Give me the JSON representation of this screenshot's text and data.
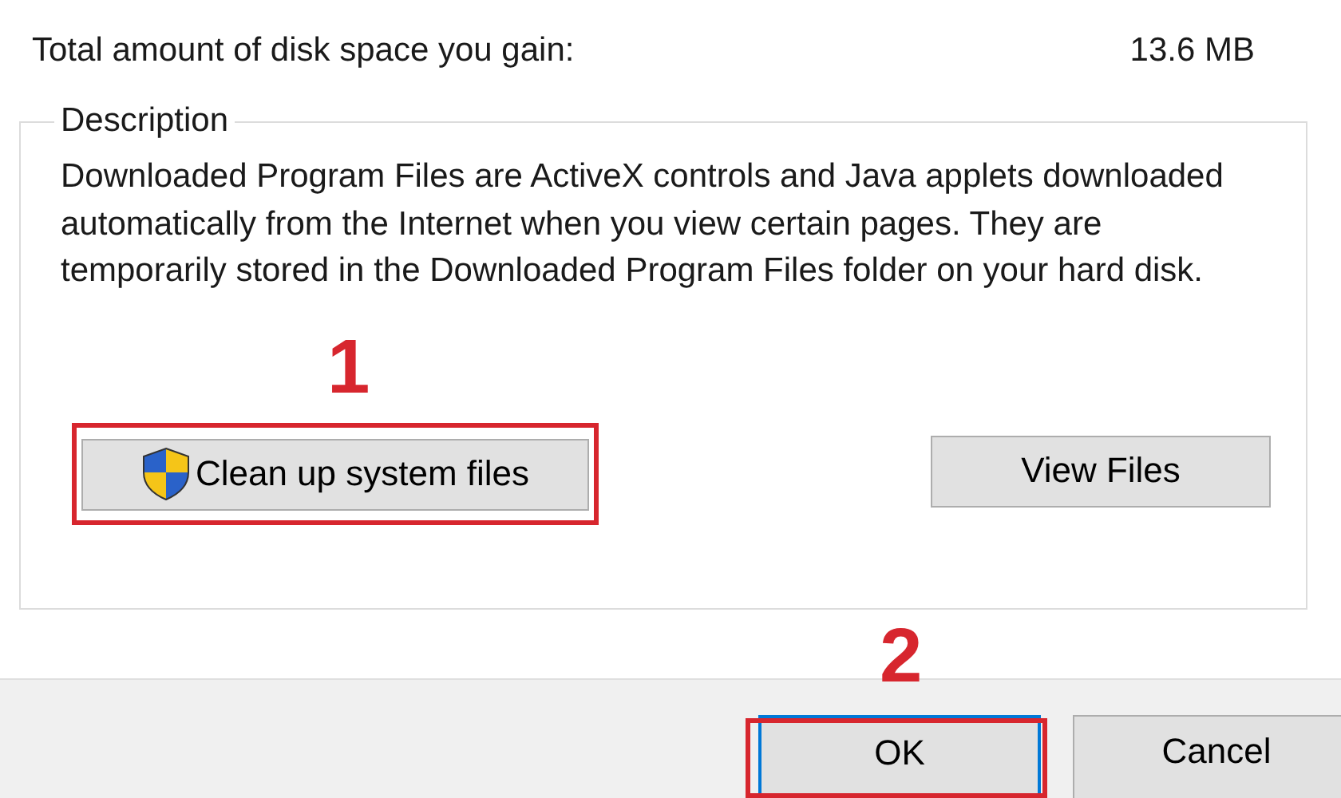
{
  "disk_space": {
    "label": "Total amount of disk space you gain:",
    "value": "13.6 MB"
  },
  "description": {
    "title": "Description",
    "text": "Downloaded Program Files are ActiveX controls and Java applets downloaded automatically from the Internet when you view certain pages. They are temporarily stored in the Downloaded Program Files folder on your hard disk."
  },
  "buttons": [
    {
      "label": "Clean up system files",
      "kind": "shield",
      "annotation": "1"
    },
    {
      "label": "View Files",
      "kind": "plain"
    }
  ],
  "dialog_buttons": [
    {
      "label": "OK",
      "default": true,
      "annotation": "2"
    },
    {
      "label": "Cancel",
      "default": false
    }
  ]
}
